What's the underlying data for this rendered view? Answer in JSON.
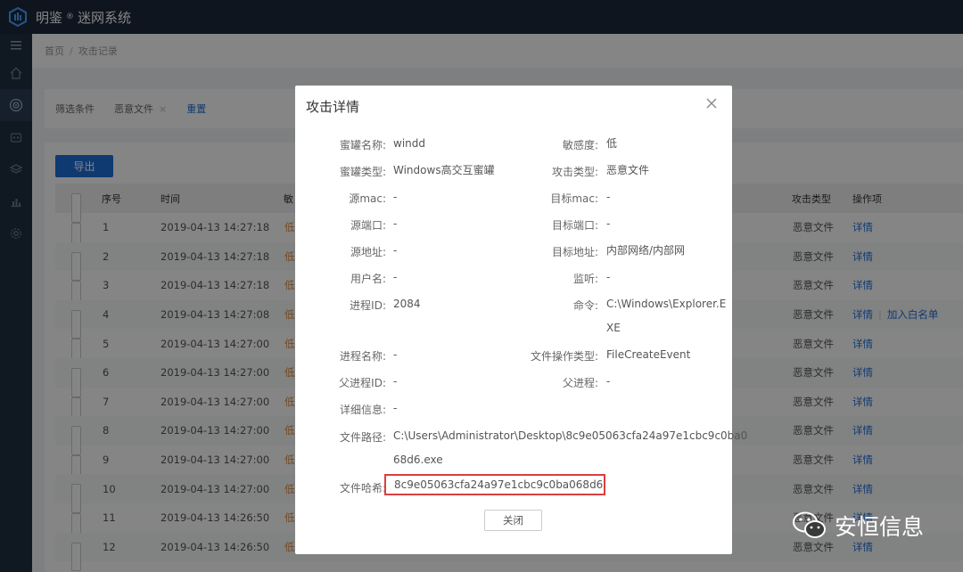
{
  "app": {
    "brand_a": "明鉴",
    "brand_sup": "®",
    "brand_b": "迷网系统"
  },
  "breadcrumb": {
    "home": "首页",
    "sep": "/",
    "current": "攻击记录"
  },
  "filter": {
    "label": "筛选条件",
    "tag": "恶意文件",
    "tag_close": "×",
    "reset": "重置"
  },
  "toolbar": {
    "export": "导出"
  },
  "table": {
    "columns": {
      "index": "序号",
      "time": "时间",
      "severity": "敏",
      "type": "攻击类型",
      "ops": "操作项"
    },
    "rows": [
      {
        "index": "1",
        "time": "2019-04-13 14:27:18",
        "sev": "低",
        "type": "恶意文件",
        "detail": "详情",
        "whitelist": ""
      },
      {
        "index": "2",
        "time": "2019-04-13 14:27:18",
        "sev": "低",
        "type": "恶意文件",
        "detail": "详情",
        "whitelist": ""
      },
      {
        "index": "3",
        "time": "2019-04-13 14:27:18",
        "sev": "低",
        "type": "恶意文件",
        "detail": "详情",
        "whitelist": ""
      },
      {
        "index": "4",
        "time": "2019-04-13 14:27:08",
        "sev": "低",
        "type": "恶意文件",
        "detail": "详情",
        "whitelist": "加入白名单"
      },
      {
        "index": "5",
        "time": "2019-04-13 14:27:00",
        "sev": "低",
        "type": "恶意文件",
        "detail": "详情",
        "whitelist": ""
      },
      {
        "index": "6",
        "time": "2019-04-13 14:27:00",
        "sev": "低",
        "type": "恶意文件",
        "detail": "详情",
        "whitelist": ""
      },
      {
        "index": "7",
        "time": "2019-04-13 14:27:00",
        "sev": "低",
        "type": "恶意文件",
        "detail": "详情",
        "whitelist": ""
      },
      {
        "index": "8",
        "time": "2019-04-13 14:27:00",
        "sev": "低",
        "type": "恶意文件",
        "detail": "详情",
        "whitelist": ""
      },
      {
        "index": "9",
        "time": "2019-04-13 14:27:00",
        "sev": "低",
        "type": "恶意文件",
        "detail": "详情",
        "whitelist": ""
      },
      {
        "index": "10",
        "time": "2019-04-13 14:27:00",
        "sev": "低",
        "type": "恶意文件",
        "detail": "详情",
        "whitelist": ""
      },
      {
        "index": "11",
        "time": "2019-04-13 14:26:50",
        "sev": "低",
        "type": "恶意文件",
        "detail": "详情",
        "whitelist": ""
      },
      {
        "index": "12",
        "time": "2019-04-13 14:26:50",
        "sev": "低",
        "type": "恶意文件",
        "detail": "详情",
        "whitelist": ""
      }
    ]
  },
  "modal": {
    "title": "攻击详情",
    "close_label": "关闭",
    "fields": {
      "honeypot_name": {
        "label": "蜜罐名称:",
        "value": "windd"
      },
      "sensitivity": {
        "label": "敏感度:",
        "value": "低"
      },
      "honeypot_type": {
        "label": "蜜罐类型:",
        "value": "Windows高交互蜜罐"
      },
      "attack_type": {
        "label": "攻击类型:",
        "value": "恶意文件"
      },
      "src_mac": {
        "label": "源mac:",
        "value": "-"
      },
      "dst_mac": {
        "label": "目标mac:",
        "value": "-"
      },
      "src_port": {
        "label": "源端口:",
        "value": "-"
      },
      "dst_port": {
        "label": "目标端口:",
        "value": "-"
      },
      "src_addr": {
        "label": "源地址:",
        "value": "-"
      },
      "dst_addr": {
        "label": "目标地址:",
        "value": "内部网络/内部网"
      },
      "username": {
        "label": "用户名:",
        "value": "-"
      },
      "listen": {
        "label": "监听:",
        "value": "-"
      },
      "pid": {
        "label": "进程ID:",
        "value": "2084"
      },
      "command": {
        "label": "命令:",
        "value_l1": "C:\\Windows\\Explorer.E",
        "value_l2": "XE"
      },
      "proc_name": {
        "label": "进程名称:",
        "value": "-"
      },
      "file_op_type": {
        "label": "文件操作类型:",
        "value": "FileCreateEvent"
      },
      "ppid": {
        "label": "父进程ID:",
        "value": "-"
      },
      "parent_proc": {
        "label": "父进程:",
        "value": "-"
      },
      "detail_info": {
        "label": "详细信息:",
        "value": "-"
      },
      "file_path": {
        "label": "文件路径:",
        "value_l1": "C:\\Users\\Administrator\\Desktop\\8c9e05063cfa24a97e1cbc9c0ba0",
        "value_l2": "68d6.exe"
      },
      "file_hash": {
        "label": "文件哈希:",
        "value": "8c9e05063cfa24a97e1cbc9c0ba068d6"
      }
    }
  },
  "watermark": {
    "text": "安恒信息"
  },
  "colors": {
    "accent": "#1e6fd9",
    "topbar": "#1b2a3d",
    "highlight": "#d84040",
    "severity": "#e08c3e"
  }
}
